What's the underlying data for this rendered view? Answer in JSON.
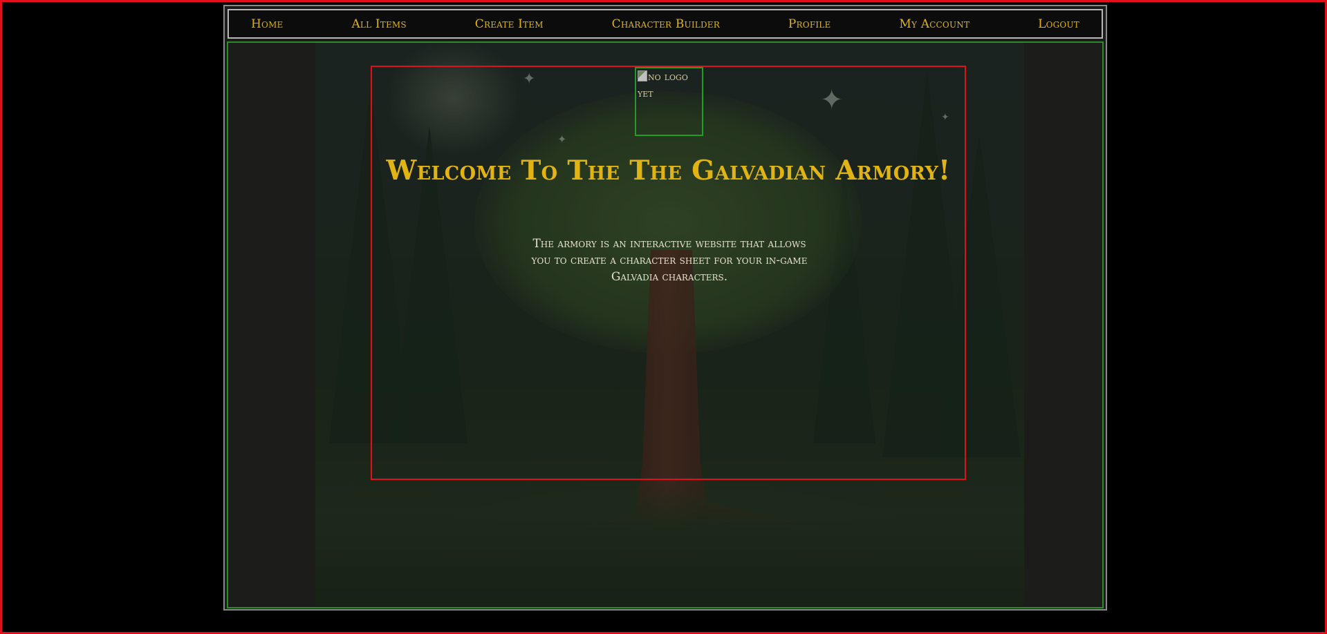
{
  "nav": {
    "items": [
      {
        "label": "Home"
      },
      {
        "label": "All Items"
      },
      {
        "label": "Create Item"
      },
      {
        "label": "Character Builder"
      },
      {
        "label": "Profile"
      },
      {
        "label": "My Account"
      },
      {
        "label": "Logout"
      }
    ]
  },
  "hero": {
    "logo_alt": "no logo yet",
    "title": "Welcome To The The Galvadian Armory!",
    "intro": "The armory is an interactive website that allows you to create a character sheet for your in-game Galvadia characters."
  },
  "colors": {
    "accent_gold": "#e1b414",
    "outer_border_red": "#e3101b",
    "content_border_green": "#2e8a2a",
    "logo_border_green": "#1f9f22",
    "background": "#000000"
  },
  "icons": {
    "broken_image": "broken-image-icon"
  }
}
